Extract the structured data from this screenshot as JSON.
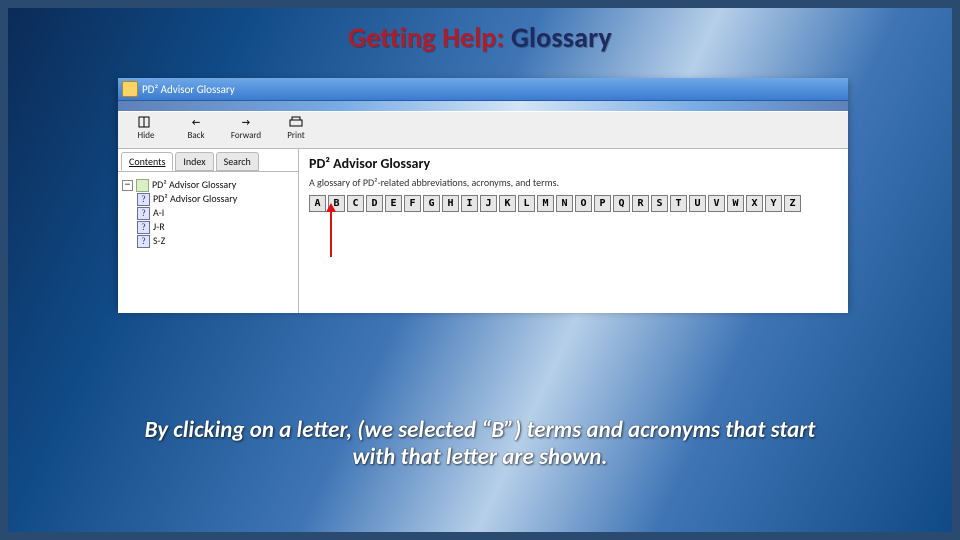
{
  "title": {
    "part1": "Getting Help:",
    "part2": "Glossary"
  },
  "help_window": {
    "titlebar": "PD² Advisor Glossary",
    "toolbar": {
      "hide": "Hide",
      "back": "Back",
      "forward": "Forward",
      "print": "Print"
    },
    "nav_tabs": {
      "contents": "Contents",
      "index": "Index",
      "search": "Search"
    },
    "tree": {
      "root": "PD² Advisor Glossary",
      "child": "PD² Advisor Glossary",
      "ai": "A-I",
      "jr": "J-R",
      "sz": "S-Z"
    },
    "content": {
      "title": "PD² Advisor Glossary",
      "subtitle": "A glossary of PD²-related abbreviations, acronyms, and terms.",
      "letters": [
        "A",
        "B",
        "C",
        "D",
        "E",
        "F",
        "G",
        "H",
        "I",
        "J",
        "K",
        "L",
        "M",
        "N",
        "O",
        "P",
        "Q",
        "R",
        "S",
        "T",
        "U",
        "V",
        "W",
        "X",
        "Y",
        "Z"
      ]
    }
  },
  "caption": "By clicking on a letter, (we selected “B”) terms and acronyms that start with that letter are shown."
}
